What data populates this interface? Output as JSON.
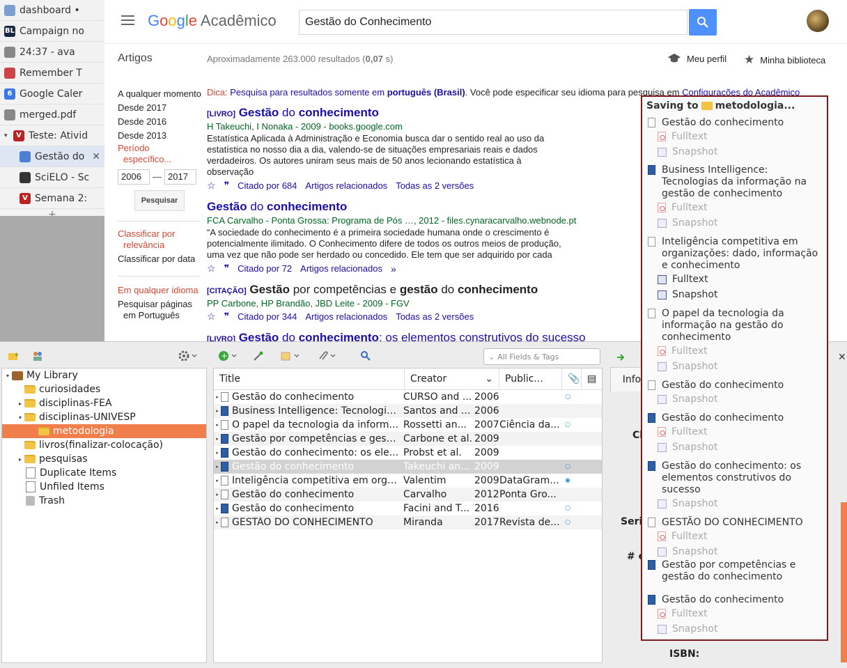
{
  "browser_tabs": [
    {
      "label": "dashboard •",
      "color": "#7a9fd0",
      "child": false
    },
    {
      "label": "Campaign no",
      "color": "#1b2a44",
      "glyph": "BL",
      "child": false
    },
    {
      "label": "24:37 - ava",
      "color": "#888888",
      "child": false
    },
    {
      "label": "Remember T",
      "color": "#c44",
      "child": false
    },
    {
      "label": "Google Caler",
      "color": "#3b78e7",
      "glyph": "6",
      "child": false
    },
    {
      "label": "merged.pdf",
      "color": "#888888",
      "child": false
    },
    {
      "label": "Teste: Ativid",
      "color": "#b22",
      "glyph": "V",
      "child": false,
      "expanded": true
    },
    {
      "label": "Gestão do",
      "color": "#4a7fd4",
      "child": true,
      "active": true
    },
    {
      "label": "SciELO - Sc",
      "color": "#333333",
      "child": true
    },
    {
      "label": "Semana 2:",
      "color": "#b22",
      "glyph": "V",
      "child": true
    }
  ],
  "scholar": {
    "logo_google": [
      "G",
      "o",
      "o",
      "g",
      "l",
      "e"
    ],
    "logo_rest": "Acadêmico",
    "query": "Gestão do Conhecimento",
    "section": "Artigos",
    "count_prefix": "Aproximadamente 263.000 resultados (",
    "count_time": "0,07",
    "count_suffix": " s)",
    "meu_perfil": "Meu perfil",
    "minha_biblioteca": "Minha biblioteca",
    "left": {
      "qualquer_momento": "A qualquer momento",
      "desde2017": "Desde 2017",
      "desde2016": "Desde 2016",
      "desde2013": "Desde 2013",
      "periodo": "Período",
      "especifico": "específico...",
      "year_from": "2006",
      "year_to": "2017",
      "pesquisar": "Pesquisar",
      "classificar_relevancia_1": "Classificar por",
      "classificar_relevancia_2": "relevância",
      "classificar_data": "Classificar por data",
      "qualquer_idioma": "Em qualquer idioma",
      "pesquisar_paginas_1": "Pesquisar páginas",
      "pesquisar_paginas_2": "em Português"
    },
    "dica": {
      "label": "Dica:",
      "text1": " Pesquisa para resultados somente em ",
      "bold": "português (Brasil)",
      "text2": ". Você pode especificar seu idioma para pesquisa em ",
      "link": "Configurações do Acadêmico"
    },
    "results": [
      {
        "tag": "[LIVRO]",
        "title_parts": [
          [
            "Gestão",
            true
          ],
          [
            " do ",
            false
          ],
          [
            "conhecimento",
            true
          ]
        ],
        "authors": "H Takeuchi, I Nonaka - 2009 - books.google.com",
        "snippet": "Estatística Aplicada à Administração e Economia busca dar o sentido real ao uso da estatística no nosso dia a dia, valendo-se de situações empresariais reais e dados verdadeiros. Os autores uniram seus mais de 50 anos lecionando estatística à observação",
        "links": [
          "Citado por 684",
          "Artigos relacionados",
          "Todas as 2 versões"
        ]
      },
      {
        "tag": "",
        "title_parts": [
          [
            "Gestão",
            true
          ],
          [
            " do ",
            false
          ],
          [
            "conhecimento",
            true
          ]
        ],
        "authors": "FCA Carvalho - Ponta Grossa: Programa de Pós …, 2012 - files.cynaracarvalho.webnode.pt",
        "snippet": "“A sociedade do conhecimento é a primeira sociedade humana onde o crescimento é potencialmente ilimitado. O Conhecimento difere de todos os outros meios de produção, uma vez que não pode ser herdado ou concedido. Ele tem que ser adquirido por cada",
        "links": [
          "Citado por 72",
          "Artigos relacionados"
        ]
      },
      {
        "tag": "[CITAÇÃO]",
        "black": true,
        "title_parts": [
          [
            "Gestão",
            true
          ],
          [
            " por competências e ",
            false
          ],
          [
            "gestão",
            true
          ],
          [
            " do ",
            false
          ],
          [
            "conhecimento",
            true
          ]
        ],
        "authors": "PP Carbone, HP Brandão, JBD Leite - 2009 - FGV",
        "snippet": "",
        "links": [
          "Citado por 344",
          "Artigos relacionados",
          "Todas as 2 versões"
        ]
      },
      {
        "tag": "[LIVRO]",
        "title_parts": [
          [
            "Gestão",
            true
          ],
          [
            " do ",
            false
          ],
          [
            "conhecimento",
            true
          ],
          [
            ": os elementos construtivos do sucesso",
            false
          ]
        ],
        "authors": "",
        "snippet": "",
        "links": []
      }
    ]
  },
  "zotero": {
    "search_placeholder": "All Fields & Tags",
    "collections": [
      {
        "label": "My Library",
        "type": "library",
        "level": 0,
        "twisty": "▾"
      },
      {
        "label": "curiosidades",
        "type": "folder",
        "level": 1,
        "twisty": ""
      },
      {
        "label": "disciplinas-FEA",
        "type": "folder",
        "level": 1,
        "twisty": "▸"
      },
      {
        "label": "disciplinas-UNIVESP",
        "type": "folder",
        "level": 1,
        "twisty": "▾"
      },
      {
        "label": "metodologia",
        "type": "folder",
        "level": 2,
        "twisty": "",
        "selected": true
      },
      {
        "label": "livros(finalizar-colocação)",
        "type": "folder",
        "level": 1,
        "twisty": ""
      },
      {
        "label": "pesquisas",
        "type": "folder",
        "level": 1,
        "twisty": "▸"
      },
      {
        "label": "Duplicate Items",
        "type": "doc",
        "level": 1,
        "twisty": ""
      },
      {
        "label": "Unfiled Items",
        "type": "doc",
        "level": 1,
        "twisty": ""
      },
      {
        "label": "Trash",
        "type": "trash",
        "level": 1,
        "twisty": ""
      }
    ],
    "columns": {
      "title": "Title",
      "creator": "Creator",
      "publication": "Public..."
    },
    "items": [
      {
        "title": "Gestão do conhecimento",
        "creator": "CURSO and ...",
        "year": "2006",
        "pub": "",
        "icon": "paper",
        "att": "○"
      },
      {
        "title": "Business Intelligence: Tecnologia...",
        "creator": "Santos and ...",
        "year": "2006",
        "pub": "",
        "icon": "book",
        "att": ""
      },
      {
        "title": "O papel da tecnologia da inform...",
        "creator": "Rossetti an...",
        "year": "2007",
        "pub": "Ciência da...",
        "icon": "paper",
        "att": "○"
      },
      {
        "title": "Gestão por competências e gestã...",
        "creator": "Carbone et al.",
        "year": "2009",
        "pub": "",
        "icon": "book",
        "att": ""
      },
      {
        "title": "Gestão do conhecimento: os ele...",
        "creator": "Probst et al.",
        "year": "2009",
        "pub": "",
        "icon": "book",
        "att": ""
      },
      {
        "title": "Gestão do conhecimento",
        "creator": "Takeuchi an...",
        "year": "2009",
        "pub": "",
        "icon": "book",
        "att": "○",
        "selected": true
      },
      {
        "title": "Inteligência competitiva em orga...",
        "creator": "Valentim",
        "year": "2009",
        "pub": "DataGram...",
        "icon": "paper",
        "att": "◉"
      },
      {
        "title": "Gestão do conhecimento",
        "creator": "Carvalho",
        "year": "2012",
        "pub": "Ponta Gro...",
        "icon": "paper",
        "att": ""
      },
      {
        "title": "Gestão do conhecimento",
        "creator": "Facini and T...",
        "year": "2016",
        "pub": "",
        "icon": "book",
        "att": "○"
      },
      {
        "title": "GESTÃO DO CONHECIMENTO",
        "creator": "Miranda",
        "year": "2017",
        "pub": "Revista de...",
        "icon": "paper",
        "att": "○"
      }
    ],
    "info_tab": "Info",
    "right_labels": [
      "Cl",
      "Seri",
      "# c",
      "ISBN:"
    ]
  },
  "saving": {
    "prefix": "Saving to",
    "collection": "metodologia...",
    "items": [
      {
        "title": "Gestão do conhecimento",
        "icon": "paper",
        "subs": [
          [
            "Fulltext",
            "pdf",
            false
          ],
          [
            "Snapshot",
            "snap",
            false
          ]
        ]
      },
      {
        "title": "Business Intelligence: Tecnologias da informação na gestão de conhecimento",
        "icon": "book",
        "subs": [
          [
            "Fulltext",
            "pdf",
            false
          ],
          [
            "Snapshot",
            "snap",
            false
          ]
        ]
      },
      {
        "title": "Inteligência competitiva em organizações: dado, informação e conhecimento",
        "icon": "paper",
        "subs": [
          [
            "Fulltext",
            "snap",
            true
          ],
          [
            "Snapshot",
            "snap",
            true
          ]
        ]
      },
      {
        "title": "O papel da tecnologia da informação na gestão do conhecimento",
        "icon": "paper",
        "subs": [
          [
            "Fulltext",
            "pdf",
            false
          ],
          [
            "Snapshot",
            "snap",
            false
          ]
        ]
      },
      {
        "title": "Gestão do conhecimento",
        "icon": "paper",
        "subs": [
          [
            "Snapshot",
            "snap",
            false
          ]
        ]
      },
      {
        "title": "Gestão do conhecimento",
        "icon": "book",
        "subs": [
          [
            "Fulltext",
            "pdf",
            false
          ],
          [
            "Snapshot",
            "snap",
            false
          ]
        ]
      },
      {
        "title": "Gestão do conhecimento: os elementos construtivos do sucesso",
        "icon": "book",
        "subs": [
          [
            "Snapshot",
            "snap",
            false
          ]
        ]
      },
      {
        "title": "GESTÃO DO CONHECIMENTO",
        "icon": "paper",
        "subs": [
          [
            "Fulltext",
            "pdf",
            false
          ],
          [
            "Snapshot",
            "snap",
            false
          ]
        ]
      },
      {
        "title": "Gestão por competências e gestão do conhecimento",
        "icon": "book",
        "subs": []
      },
      {
        "title": "Gestão do conhecimento",
        "icon": "book",
        "subs": [
          [
            "Fulltext",
            "pdf",
            false
          ],
          [
            "Snapshot",
            "snap",
            false
          ]
        ]
      }
    ]
  }
}
